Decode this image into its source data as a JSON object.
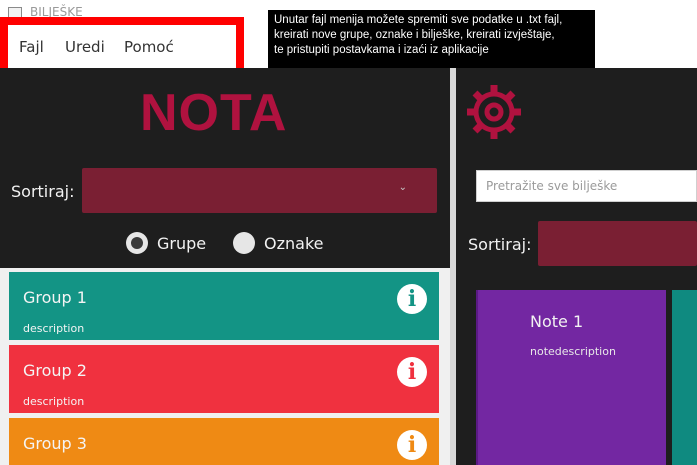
{
  "window": {
    "title": "BILJEŠKE"
  },
  "menu": {
    "items": [
      "Fajl",
      "Uredi",
      "Pomoć"
    ]
  },
  "tooltip": {
    "lines": [
      "Unutar fajl menija možete spremiti sve podatke u .txt fajl,",
      "kreirati nove grupe, oznake i bilješke, kreirati izvještaje,",
      "te pristupiti postavkama i izaći iz aplikacije"
    ]
  },
  "left": {
    "logo": "NOTA",
    "sort_label": "Sortiraj:",
    "sort_chevron": "⌄",
    "radio": {
      "option1": "Grupe",
      "option2": "Oznake",
      "selected": "Grupe"
    },
    "groups": [
      {
        "title": "Group 1",
        "description": "description",
        "color": "#139485"
      },
      {
        "title": "Group 2",
        "description": "description",
        "color": "#f0313f"
      },
      {
        "title": "Group 3",
        "description": "",
        "color": "#ef8a14"
      }
    ],
    "info_glyph": "i"
  },
  "right": {
    "search_placeholder": "Pretražite sve bilješke",
    "sort_label": "Sortiraj:",
    "notes": [
      {
        "title": "Note 1",
        "description": "notedescription",
        "color": "#7327a2"
      }
    ]
  },
  "colors": {
    "accent": "#b0123f",
    "sort_box": "#7a1f33",
    "highlight": "#ff0000"
  }
}
